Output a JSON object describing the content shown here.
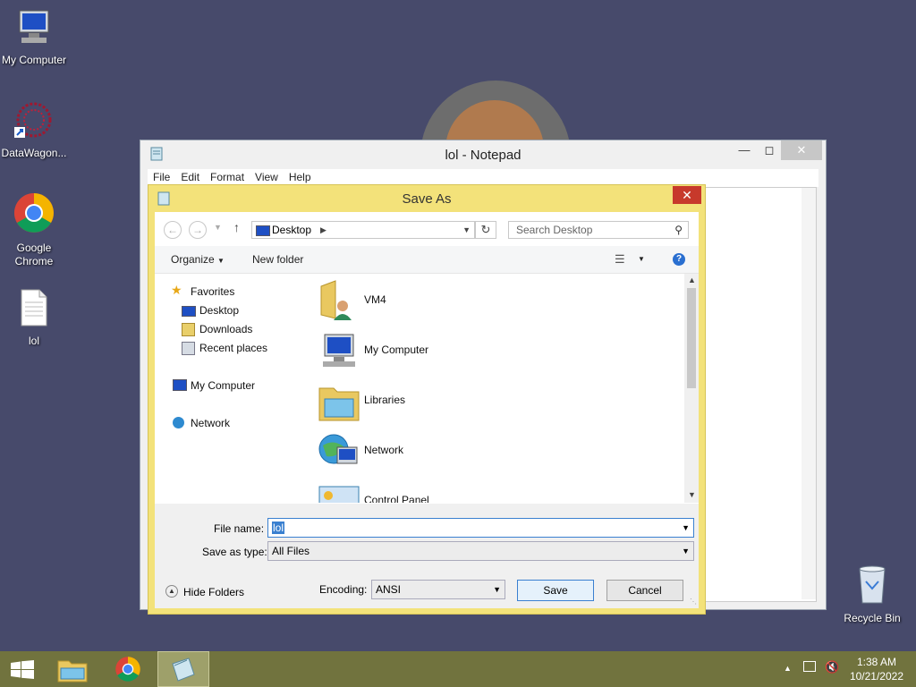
{
  "desktop": {
    "icons": [
      {
        "label": "My Computer"
      },
      {
        "label": "DataWagon..."
      },
      {
        "label": "Google Chrome"
      },
      {
        "label": "lol"
      },
      {
        "label": "Recycle Bin"
      }
    ]
  },
  "notepad": {
    "title": "lol - Notepad",
    "menu": [
      "File",
      "Edit",
      "Format",
      "View",
      "Help"
    ]
  },
  "save_dialog": {
    "title": "Save As",
    "address": "Desktop",
    "search_placeholder": "Search Desktop",
    "toolbar": {
      "organize": "Organize",
      "new_folder": "New folder"
    },
    "nav": {
      "favorites": "Favorites",
      "desktop": "Desktop",
      "downloads": "Downloads",
      "recent": "Recent places",
      "my_computer": "My Computer",
      "network": "Network"
    },
    "files": [
      "VM4",
      "My Computer",
      "Libraries",
      "Network",
      "Control Panel"
    ],
    "file_name_label": "File name:",
    "file_name_value": "lol",
    "save_type_label": "Save as type:",
    "save_type_value": "All Files",
    "hide_folders": "Hide Folders",
    "encoding_label": "Encoding:",
    "encoding_value": "ANSI",
    "save_button": "Save",
    "cancel_button": "Cancel"
  },
  "taskbar": {
    "time": "1:38 AM",
    "date": "10/21/2022"
  },
  "colors": {
    "dialog_frame": "#f3e27a",
    "taskbar": "#71733e",
    "desktop": "#474a6b"
  }
}
